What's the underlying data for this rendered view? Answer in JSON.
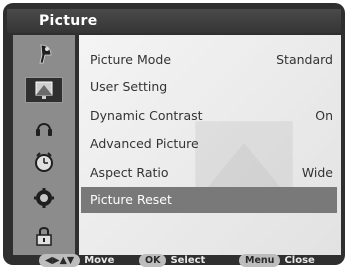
{
  "window": {
    "title": "Picture"
  },
  "sidebar": {
    "items": [
      {
        "icon": "antenna-icon",
        "selected": false
      },
      {
        "icon": "picture-icon",
        "selected": true
      },
      {
        "icon": "sound-icon",
        "selected": false
      },
      {
        "icon": "clock-icon",
        "selected": false
      },
      {
        "icon": "setup-icon",
        "selected": false
      },
      {
        "icon": "lock-icon",
        "selected": false
      }
    ]
  },
  "menu": {
    "items": [
      {
        "label": "Picture Mode",
        "value": "Standard"
      },
      {
        "label": "User Setting",
        "value": ""
      },
      {
        "label": "Dynamic Contrast",
        "value": "On"
      },
      {
        "label": "Advanced Picture",
        "value": ""
      },
      {
        "label": "Aspect Ratio",
        "value": "Wide"
      },
      {
        "label": "Picture Reset",
        "value": "",
        "highlighted": true
      }
    ]
  },
  "footer": {
    "move_key": "◀▶▲▼",
    "move_label": "Move",
    "select_key": "OK",
    "select_label": "Select",
    "close_key": "Menu",
    "close_label": "Close"
  },
  "colors": {
    "frame": "#2f2f2f",
    "sidebar": "#8c8c8c",
    "highlight": "#797979"
  }
}
